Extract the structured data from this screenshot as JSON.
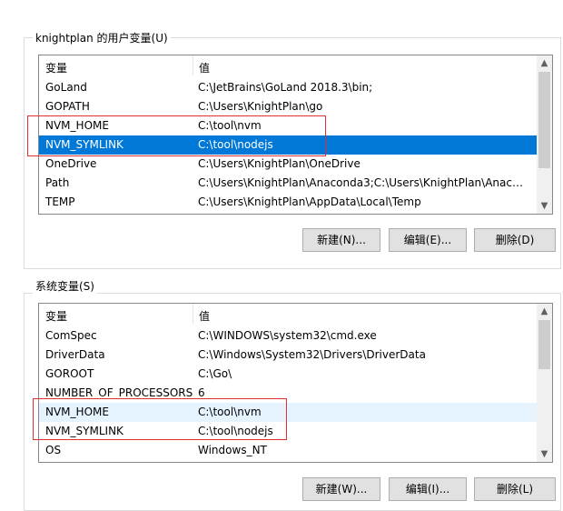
{
  "user_section": {
    "title": "knightplan 的用户变量(U)",
    "col_variable": "变量",
    "col_value": "值",
    "rows": [
      {
        "name": "GoLand",
        "value": "C:\\JetBrains\\GoLand 2018.3\\bin;"
      },
      {
        "name": "GOPATH",
        "value": "C:\\Users\\KnightPlan\\go"
      },
      {
        "name": "NVM_HOME",
        "value": "C:\\tool\\nvm"
      },
      {
        "name": "NVM_SYMLINK",
        "value": "C:\\tool\\nodejs"
      },
      {
        "name": "OneDrive",
        "value": "C:\\Users\\KnightPlan\\OneDrive"
      },
      {
        "name": "Path",
        "value": "C:\\Users\\KnightPlan\\Anaconda3;C:\\Users\\KnightPlan\\Anacon..."
      },
      {
        "name": "TEMP",
        "value": "C:\\Users\\KnightPlan\\AppData\\Local\\Temp"
      }
    ],
    "buttons": {
      "new": "新建(N)...",
      "edit": "编辑(E)...",
      "delete": "删除(D)"
    }
  },
  "system_section": {
    "title": "系统变量(S)",
    "col_variable": "变量",
    "col_value": "值",
    "rows": [
      {
        "name": "ComSpec",
        "value": "C:\\WINDOWS\\system32\\cmd.exe"
      },
      {
        "name": "DriverData",
        "value": "C:\\Windows\\System32\\Drivers\\DriverData"
      },
      {
        "name": "GOROOT",
        "value": "C:\\Go\\"
      },
      {
        "name": "NUMBER_OF_PROCESSORS",
        "value": "6"
      },
      {
        "name": "NVM_HOME",
        "value": "C:\\tool\\nvm"
      },
      {
        "name": "NVM_SYMLINK",
        "value": "C:\\tool\\nodejs"
      },
      {
        "name": "OS",
        "value": "Windows_NT"
      }
    ],
    "buttons": {
      "new": "新建(W)...",
      "edit": "编辑(I)...",
      "delete": "删除(L)"
    }
  },
  "colors": {
    "selection": "#0078d7",
    "annotation": "#e03030"
  },
  "icons": {
    "scroll_up": "chevron-up-icon",
    "scroll_down": "chevron-down-icon"
  }
}
